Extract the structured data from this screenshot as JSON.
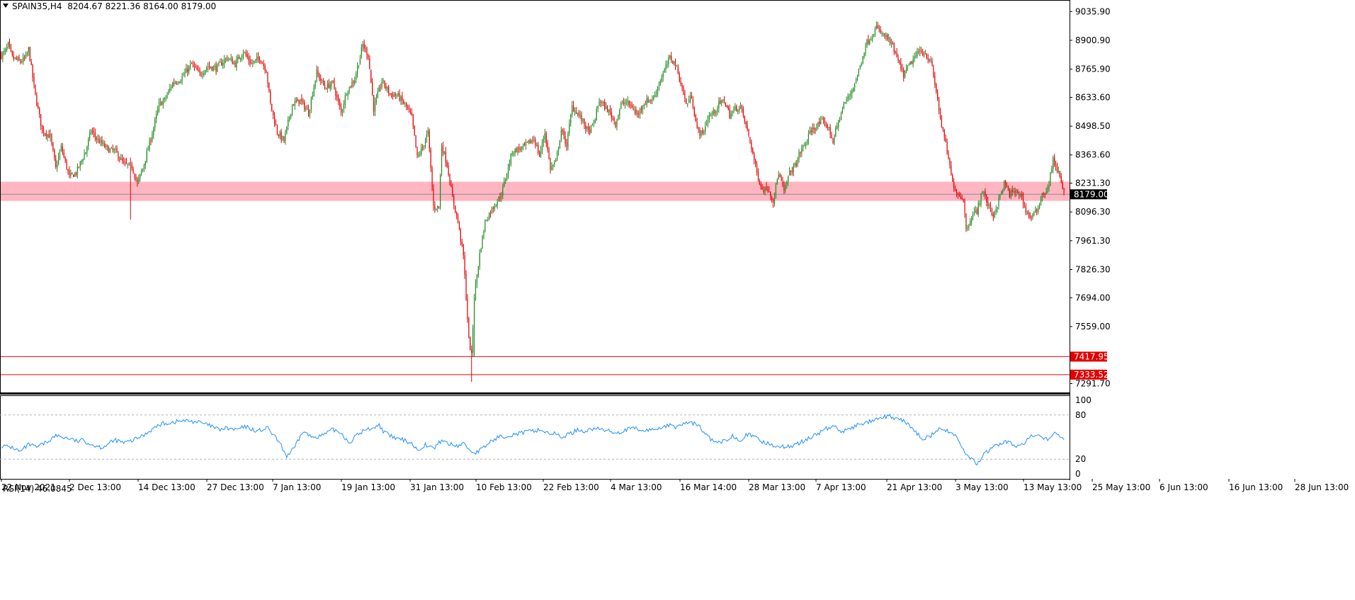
{
  "symbol": "SPAIN35,H4",
  "ohlc": {
    "open": "8204.67",
    "high": "8221.36",
    "low": "8164.00",
    "close": "8179.00"
  },
  "rsi": {
    "label": "RSI(14)",
    "value": "46.0845",
    "levels": [
      "100",
      "80",
      "20",
      "0"
    ]
  },
  "price_axis": [
    "9035.90",
    "8900.90",
    "8765.90",
    "8633.60",
    "8498.50",
    "8363.60",
    "8231.30",
    "8096.30",
    "7961.30",
    "7826.30",
    "7694.00",
    "7559.00",
    "7291.70"
  ],
  "price_tags": {
    "current": "8179.00",
    "line1": "7417.95",
    "line2": "7333.52"
  },
  "time_axis": [
    "22 Nov 2021",
    "2 Dec 13:00",
    "14 Dec 13:00",
    "27 Dec 13:00",
    "7 Jan 13:00",
    "19 Jan 13:00",
    "31 Jan 13:00",
    "10 Feb 13:00",
    "22 Feb 13:00",
    "4 Mar 13:00",
    "16 Mar 14:00",
    "28 Mar 13:00",
    "7 Apr 13:00",
    "21 Apr 13:00",
    "3 May 13:00",
    "13 May 13:00",
    "25 May 13:00",
    "6 Jun 13:00",
    "16 Jun 13:00",
    "28 Jun 13:00"
  ],
  "colors": {
    "bull": "#1e8a1e",
    "bear": "#e00000",
    "zone": "#ffb6c1",
    "hline": "#ff0000",
    "rsi": "#1e90ff",
    "tag_current": "#000000",
    "tag_line": "#e00000"
  },
  "chart_data": {
    "type": "candlestick",
    "ylim": [
      7250,
      9090
    ],
    "zone": [
      8148,
      8238
    ],
    "current_price": 8179.0,
    "hlines": [
      7417.95,
      7333.52
    ],
    "anchors_close": [
      [
        0,
        8830
      ],
      [
        3,
        8850
      ],
      [
        5,
        8880
      ],
      [
        8,
        8820
      ],
      [
        14,
        8800
      ],
      [
        18,
        8820
      ],
      [
        20,
        8860
      ],
      [
        25,
        8640
      ],
      [
        30,
        8480
      ],
      [
        36,
        8450
      ],
      [
        40,
        8300
      ],
      [
        44,
        8400
      ],
      [
        50,
        8260
      ],
      [
        55,
        8280
      ],
      [
        62,
        8380
      ],
      [
        66,
        8480
      ],
      [
        70,
        8440
      ],
      [
        78,
        8390
      ],
      [
        84,
        8380
      ],
      [
        90,
        8320
      ],
      [
        96,
        8310
      ],
      [
        100,
        8230
      ],
      [
        104,
        8300
      ],
      [
        110,
        8440
      ],
      [
        116,
        8600
      ],
      [
        120,
        8620
      ],
      [
        126,
        8700
      ],
      [
        132,
        8720
      ],
      [
        140,
        8790
      ],
      [
        146,
        8740
      ],
      [
        152,
        8780
      ],
      [
        158,
        8770
      ],
      [
        166,
        8820
      ],
      [
        172,
        8790
      ],
      [
        178,
        8850
      ],
      [
        184,
        8790
      ],
      [
        190,
        8820
      ],
      [
        195,
        8760
      ],
      [
        198,
        8600
      ],
      [
        203,
        8470
      ],
      [
        208,
        8430
      ],
      [
        214,
        8600
      ],
      [
        220,
        8620
      ],
      [
        226,
        8560
      ],
      [
        232,
        8750
      ],
      [
        238,
        8680
      ],
      [
        244,
        8700
      ],
      [
        250,
        8560
      ],
      [
        254,
        8660
      ],
      [
        260,
        8720
      ],
      [
        266,
        8880
      ],
      [
        270,
        8830
      ],
      [
        274,
        8580
      ],
      [
        280,
        8710
      ],
      [
        286,
        8650
      ],
      [
        292,
        8640
      ],
      [
        298,
        8590
      ],
      [
        302,
        8540
      ],
      [
        306,
        8350
      ],
      [
        310,
        8400
      ],
      [
        314,
        8470
      ],
      [
        318,
        8120
      ],
      [
        322,
        8120
      ],
      [
        324,
        8410
      ],
      [
        328,
        8320
      ],
      [
        332,
        8160
      ],
      [
        336,
        8050
      ],
      [
        340,
        7890
      ],
      [
        342,
        7700
      ],
      [
        344,
        7500
      ],
      [
        346,
        7420
      ],
      [
        348,
        7700
      ],
      [
        352,
        7900
      ],
      [
        356,
        8050
      ],
      [
        360,
        8100
      ],
      [
        364,
        8140
      ],
      [
        368,
        8180
      ],
      [
        372,
        8280
      ],
      [
        376,
        8380
      ],
      [
        380,
        8390
      ],
      [
        384,
        8400
      ],
      [
        388,
        8420
      ],
      [
        392,
        8440
      ],
      [
        396,
        8360
      ],
      [
        400,
        8470
      ],
      [
        404,
        8300
      ],
      [
        408,
        8330
      ],
      [
        412,
        8480
      ],
      [
        416,
        8410
      ],
      [
        420,
        8590
      ],
      [
        424,
        8560
      ],
      [
        428,
        8520
      ],
      [
        432,
        8470
      ],
      [
        436,
        8510
      ],
      [
        440,
        8620
      ],
      [
        444,
        8590
      ],
      [
        448,
        8560
      ],
      [
        452,
        8510
      ],
      [
        456,
        8600
      ],
      [
        460,
        8610
      ],
      [
        464,
        8590
      ],
      [
        468,
        8550
      ],
      [
        472,
        8600
      ],
      [
        476,
        8620
      ],
      [
        480,
        8630
      ],
      [
        484,
        8700
      ],
      [
        488,
        8760
      ],
      [
        492,
        8820
      ],
      [
        496,
        8790
      ],
      [
        500,
        8700
      ],
      [
        504,
        8600
      ],
      [
        508,
        8640
      ],
      [
        512,
        8480
      ],
      [
        516,
        8460
      ],
      [
        520,
        8540
      ],
      [
        524,
        8560
      ],
      [
        528,
        8600
      ],
      [
        532,
        8620
      ],
      [
        536,
        8550
      ],
      [
        540,
        8580
      ],
      [
        544,
        8590
      ],
      [
        548,
        8500
      ],
      [
        552,
        8400
      ],
      [
        556,
        8280
      ],
      [
        560,
        8200
      ],
      [
        564,
        8210
      ],
      [
        568,
        8150
      ],
      [
        572,
        8280
      ],
      [
        576,
        8190
      ],
      [
        580,
        8280
      ],
      [
        584,
        8310
      ],
      [
        588,
        8380
      ],
      [
        592,
        8420
      ],
      [
        596,
        8480
      ],
      [
        600,
        8500
      ],
      [
        604,
        8520
      ],
      [
        608,
        8500
      ],
      [
        612,
        8430
      ],
      [
        616,
        8520
      ],
      [
        620,
        8600
      ],
      [
        624,
        8640
      ],
      [
        628,
        8700
      ],
      [
        632,
        8780
      ],
      [
        636,
        8880
      ],
      [
        640,
        8920
      ],
      [
        644,
        8960
      ],
      [
        648,
        8930
      ],
      [
        652,
        8910
      ],
      [
        656,
        8870
      ],
      [
        660,
        8800
      ],
      [
        664,
        8740
      ],
      [
        668,
        8780
      ],
      [
        672,
        8820
      ],
      [
        676,
        8850
      ],
      [
        680,
        8840
      ],
      [
        684,
        8800
      ],
      [
        688,
        8660
      ],
      [
        692,
        8500
      ],
      [
        696,
        8380
      ],
      [
        700,
        8230
      ],
      [
        704,
        8180
      ],
      [
        708,
        8160
      ],
      [
        710,
        8010
      ],
      [
        714,
        8080
      ],
      [
        718,
        8100
      ],
      [
        722,
        8200
      ],
      [
        726,
        8130
      ],
      [
        730,
        8080
      ],
      [
        734,
        8150
      ],
      [
        738,
        8230
      ],
      [
        742,
        8180
      ],
      [
        746,
        8190
      ],
      [
        750,
        8180
      ],
      [
        754,
        8100
      ],
      [
        758,
        8070
      ],
      [
        762,
        8100
      ],
      [
        766,
        8180
      ],
      [
        770,
        8200
      ],
      [
        774,
        8340
      ],
      [
        778,
        8280
      ],
      [
        782,
        8179
      ]
    ],
    "rsi_anchors": [
      [
        0,
        38
      ],
      [
        8,
        36
      ],
      [
        14,
        30
      ],
      [
        20,
        40
      ],
      [
        26,
        36
      ],
      [
        34,
        44
      ],
      [
        40,
        52
      ],
      [
        50,
        48
      ],
      [
        56,
        44
      ],
      [
        60,
        46
      ],
      [
        66,
        40
      ],
      [
        74,
        36
      ],
      [
        84,
        46
      ],
      [
        90,
        42
      ],
      [
        96,
        45
      ],
      [
        104,
        52
      ],
      [
        112,
        62
      ],
      [
        118,
        68
      ],
      [
        126,
        70
      ],
      [
        132,
        72
      ],
      [
        138,
        72
      ],
      [
        146,
        70
      ],
      [
        154,
        65
      ],
      [
        160,
        60
      ],
      [
        166,
        62
      ],
      [
        172,
        60
      ],
      [
        180,
        64
      ],
      [
        188,
        58
      ],
      [
        196,
        62
      ],
      [
        204,
        44
      ],
      [
        210,
        24
      ],
      [
        216,
        36
      ],
      [
        222,
        58
      ],
      [
        228,
        50
      ],
      [
        236,
        52
      ],
      [
        244,
        60
      ],
      [
        250,
        56
      ],
      [
        256,
        42
      ],
      [
        260,
        50
      ],
      [
        266,
        58
      ],
      [
        272,
        62
      ],
      [
        278,
        66
      ],
      [
        282,
        56
      ],
      [
        290,
        48
      ],
      [
        296,
        46
      ],
      [
        302,
        42
      ],
      [
        306,
        32
      ],
      [
        312,
        40
      ],
      [
        318,
        34
      ],
      [
        324,
        46
      ],
      [
        330,
        40
      ],
      [
        336,
        38
      ],
      [
        340,
        42
      ],
      [
        344,
        34
      ],
      [
        348,
        28
      ],
      [
        354,
        34
      ],
      [
        360,
        44
      ],
      [
        366,
        50
      ],
      [
        372,
        52
      ],
      [
        378,
        54
      ],
      [
        384,
        56
      ],
      [
        390,
        58
      ],
      [
        396,
        60
      ],
      [
        402,
        56
      ],
      [
        408,
        54
      ],
      [
        412,
        50
      ],
      [
        418,
        54
      ],
      [
        424,
        60
      ],
      [
        430,
        58
      ],
      [
        436,
        62
      ],
      [
        442,
        60
      ],
      [
        448,
        58
      ],
      [
        454,
        56
      ],
      [
        460,
        60
      ],
      [
        466,
        62
      ],
      [
        472,
        58
      ],
      [
        478,
        60
      ],
      [
        484,
        62
      ],
      [
        490,
        66
      ],
      [
        496,
        64
      ],
      [
        502,
        68
      ],
      [
        508,
        70
      ],
      [
        514,
        64
      ],
      [
        520,
        50
      ],
      [
        526,
        42
      ],
      [
        532,
        44
      ],
      [
        538,
        52
      ],
      [
        544,
        46
      ],
      [
        548,
        54
      ],
      [
        554,
        50
      ],
      [
        560,
        44
      ],
      [
        566,
        40
      ],
      [
        572,
        38
      ],
      [
        578,
        36
      ],
      [
        584,
        40
      ],
      [
        590,
        44
      ],
      [
        596,
        50
      ],
      [
        602,
        56
      ],
      [
        608,
        62
      ],
      [
        614,
        64
      ],
      [
        618,
        58
      ],
      [
        624,
        60
      ],
      [
        630,
        66
      ],
      [
        636,
        70
      ],
      [
        642,
        72
      ],
      [
        648,
        76
      ],
      [
        654,
        78
      ],
      [
        660,
        74
      ],
      [
        666,
        70
      ],
      [
        672,
        58
      ],
      [
        678,
        48
      ],
      [
        684,
        52
      ],
      [
        690,
        60
      ],
      [
        696,
        58
      ],
      [
        702,
        54
      ],
      [
        706,
        38
      ],
      [
        712,
        22
      ],
      [
        718,
        14
      ],
      [
        722,
        24
      ],
      [
        728,
        34
      ],
      [
        734,
        40
      ],
      [
        740,
        44
      ],
      [
        746,
        38
      ],
      [
        752,
        40
      ],
      [
        758,
        52
      ],
      [
        764,
        50
      ],
      [
        770,
        46
      ],
      [
        776,
        58
      ],
      [
        780,
        50
      ],
      [
        782,
        46
      ]
    ]
  }
}
